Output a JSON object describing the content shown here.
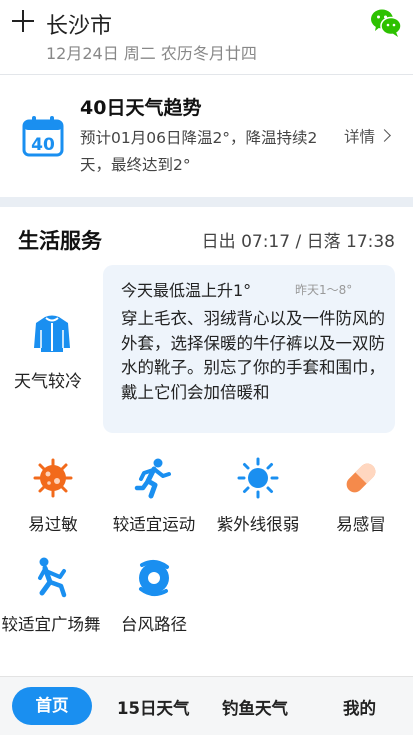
{
  "header": {
    "city": "长沙市",
    "date": "12月24日 周二 农历冬月廿四"
  },
  "trend": {
    "calendar_number": "40",
    "title": "40日天气趋势",
    "description": "预计01月06日降温2°，降温持续2天，最终达到2°",
    "detail_label": "详情"
  },
  "life": {
    "title": "生活服务",
    "sun_times": "日出 07:17 / 日落 17:38",
    "dressing": {
      "label": "天气较冷",
      "main": "今天最低温上升1°",
      "sub": "昨天1～8°",
      "advice": "穿上毛衣、羽绒背心以及一件防风的外套，选择保暖的牛仔裤以及一双防水的靴子。别忘了你的手套和围巾，戴上它们会加倍暖和"
    },
    "items": [
      {
        "label": "易过敏",
        "icon": "allergy-icon"
      },
      {
        "label": "较适宜运动",
        "icon": "running-icon"
      },
      {
        "label": "紫外线很弱",
        "icon": "uv-sun-icon"
      },
      {
        "label": "易感冒",
        "icon": "pill-icon"
      },
      {
        "label": "较适宜广场舞",
        "icon": "dance-icon"
      },
      {
        "label": "台风路径",
        "icon": "typhoon-icon"
      }
    ]
  },
  "tabs": [
    {
      "label": "首页",
      "active": true
    },
    {
      "label": "15日天气"
    },
    {
      "label": "钓鱼天气"
    },
    {
      "label": "我的"
    }
  ],
  "colors": {
    "accent": "#1a8ff0",
    "allergy": "#f26a1b",
    "pill": "#f58a4b",
    "background_gap": "#e9eef4",
    "bubble": "#eef4fb"
  }
}
